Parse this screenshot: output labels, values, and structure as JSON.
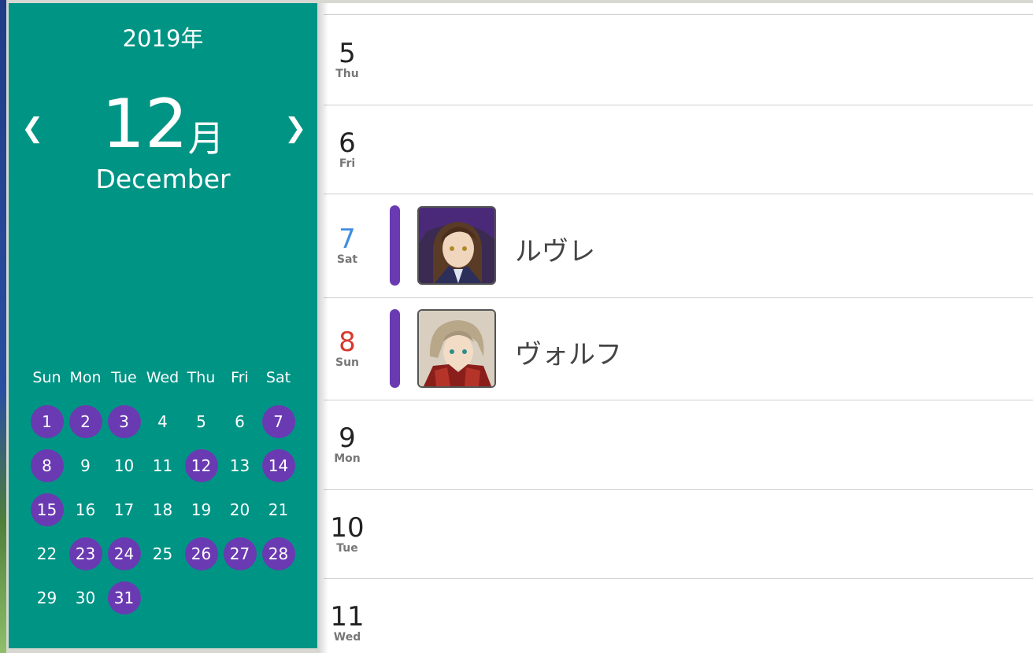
{
  "sidebar": {
    "year": "2019年",
    "prev_icon": "chevron-left-icon",
    "next_icon": "chevron-right-icon",
    "month_number": "12",
    "month_kanji": "月",
    "month_english": "December",
    "weekday_headers": [
      "Sun",
      "Mon",
      "Tue",
      "Wed",
      "Thu",
      "Fri",
      "Sat"
    ],
    "weeks": [
      [
        {
          "d": "1",
          "hl": true
        },
        {
          "d": "2",
          "hl": true
        },
        {
          "d": "3",
          "hl": true
        },
        {
          "d": "4",
          "hl": false
        },
        {
          "d": "5",
          "hl": false
        },
        {
          "d": "6",
          "hl": false
        },
        {
          "d": "7",
          "hl": true
        }
      ],
      [
        {
          "d": "8",
          "hl": true
        },
        {
          "d": "9",
          "hl": false
        },
        {
          "d": "10",
          "hl": false
        },
        {
          "d": "11",
          "hl": false
        },
        {
          "d": "12",
          "hl": true
        },
        {
          "d": "13",
          "hl": false
        },
        {
          "d": "14",
          "hl": true
        }
      ],
      [
        {
          "d": "15",
          "hl": true
        },
        {
          "d": "16",
          "hl": false
        },
        {
          "d": "17",
          "hl": false
        },
        {
          "d": "18",
          "hl": false
        },
        {
          "d": "19",
          "hl": false
        },
        {
          "d": "20",
          "hl": false
        },
        {
          "d": "21",
          "hl": false
        }
      ],
      [
        {
          "d": "22",
          "hl": false
        },
        {
          "d": "23",
          "hl": true
        },
        {
          "d": "24",
          "hl": true
        },
        {
          "d": "25",
          "hl": false
        },
        {
          "d": "26",
          "hl": true
        },
        {
          "d": "27",
          "hl": true
        },
        {
          "d": "28",
          "hl": true
        }
      ],
      [
        {
          "d": "29",
          "hl": false
        },
        {
          "d": "30",
          "hl": false
        },
        {
          "d": "31",
          "hl": true
        }
      ]
    ]
  },
  "days": [
    {
      "day": "5",
      "weekday": "Thu",
      "type": "weekday",
      "event": null
    },
    {
      "day": "6",
      "weekday": "Fri",
      "type": "weekday",
      "event": null
    },
    {
      "day": "7",
      "weekday": "Sat",
      "type": "sat",
      "event": {
        "name": "ルヴレ",
        "avatar_icon": "character-portrait-purple-hood"
      }
    },
    {
      "day": "8",
      "weekday": "Sun",
      "type": "sun",
      "event": {
        "name": "ヴォルフ",
        "avatar_icon": "character-portrait-red-armor"
      }
    },
    {
      "day": "9",
      "weekday": "Mon",
      "type": "weekday",
      "event": null
    },
    {
      "day": "10",
      "weekday": "Tue",
      "type": "weekday",
      "event": null
    },
    {
      "day": "11",
      "weekday": "Wed",
      "type": "weekday",
      "event": null
    }
  ],
  "colors": {
    "sidebar_bg": "#009485",
    "highlight": "#6a3ab2",
    "saturday": "#3f8fe0",
    "sunday": "#d63a2f"
  }
}
